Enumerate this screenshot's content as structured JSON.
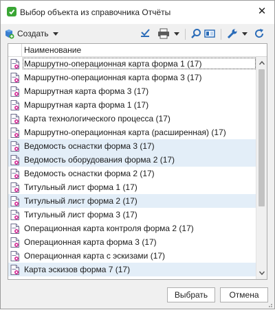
{
  "window": {
    "title": "Выбор объекта из справочника Отчёты",
    "close_symbol": "✕"
  },
  "toolbar": {
    "create_label": "Создать",
    "icons": [
      "create-icon",
      "check-icon",
      "print-icon",
      "find-icon",
      "columns-icon",
      "settings-icon",
      "refresh-icon"
    ]
  },
  "list": {
    "column_header": "Наименование",
    "items": [
      {
        "label": "Маршрутно-операционная карта форма 1 (17)",
        "highlighted": false,
        "selected": true
      },
      {
        "label": "Маршрутно-операционная карта форма 3 (17)",
        "highlighted": false,
        "selected": false
      },
      {
        "label": "Маршрутная карта форма 3 (17)",
        "highlighted": false,
        "selected": false
      },
      {
        "label": "Маршрутная карта форма 1 (17)",
        "highlighted": false,
        "selected": false
      },
      {
        "label": "Карта технологического процесса (17)",
        "highlighted": false,
        "selected": false
      },
      {
        "label": "Маршрутно-операционная карта (расширенная) (17)",
        "highlighted": false,
        "selected": false
      },
      {
        "label": "Ведомость оснастки форма 3 (17)",
        "highlighted": true,
        "selected": false
      },
      {
        "label": "Ведомость оборудования форма 2 (17)",
        "highlighted": true,
        "selected": false
      },
      {
        "label": "Ведомость оснастки форма 2 (17)",
        "highlighted": false,
        "selected": false
      },
      {
        "label": "Титульный лист форма 1 (17)",
        "highlighted": false,
        "selected": false
      },
      {
        "label": "Титульный лист форма 2 (17)",
        "highlighted": true,
        "selected": false
      },
      {
        "label": "Титульный лист форма 3 (17)",
        "highlighted": false,
        "selected": false
      },
      {
        "label": "Операционная карта контроля форма 2 (17)",
        "highlighted": false,
        "selected": false
      },
      {
        "label": "Операционная карта форма 3 (17)",
        "highlighted": false,
        "selected": false
      },
      {
        "label": "Операционная карта с эскизами (17)",
        "highlighted": false,
        "selected": false
      },
      {
        "label": "Карта эскизов форма 7 (17)",
        "highlighted": true,
        "selected": false
      }
    ]
  },
  "buttons": {
    "ok_label": "Выбрать",
    "cancel_label": "Отмена"
  },
  "colors": {
    "row_highlight": "#e3eef8",
    "app_icon": "#3aa635",
    "toolbar_blue": "#2b6cb8"
  }
}
